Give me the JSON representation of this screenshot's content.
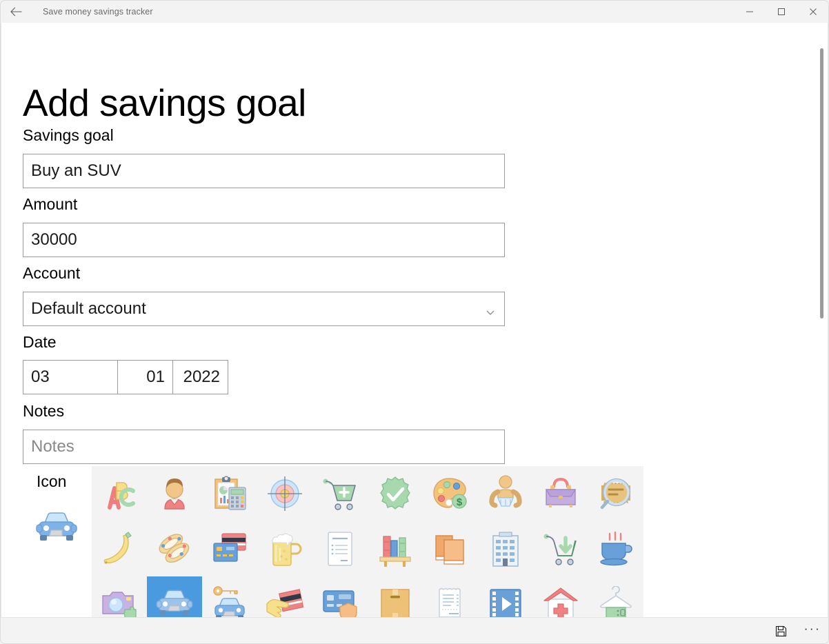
{
  "window": {
    "title": "Save money savings tracker",
    "back_icon": "back-arrow-icon",
    "minimize_label": "–",
    "maximize_label": "□",
    "close_label": "✕"
  },
  "page": {
    "heading": "Add savings goal"
  },
  "form": {
    "savings_goal": {
      "label": "Savings goal",
      "value": "Buy an SUV"
    },
    "amount": {
      "label": "Amount",
      "value": "30000"
    },
    "account": {
      "label": "Account",
      "value": "Default account",
      "options": [
        "Default account"
      ]
    },
    "date": {
      "label": "Date",
      "day": "03",
      "month": "01",
      "year": "2022"
    },
    "notes": {
      "label": "Notes",
      "value": "",
      "placeholder": "Notes"
    },
    "icon": {
      "label": "Icon",
      "selected_index": 21,
      "selected_name": "car-icon",
      "items": [
        {
          "name": "abc-blocks-icon"
        },
        {
          "name": "person-avatar-icon"
        },
        {
          "name": "clipboard-calculator-icon"
        },
        {
          "name": "target-bullseye-icon"
        },
        {
          "name": "cart-add-icon"
        },
        {
          "name": "check-badge-icon"
        },
        {
          "name": "art-palette-money-icon"
        },
        {
          "name": "baby-icon"
        },
        {
          "name": "handbag-icon"
        },
        {
          "name": "magnifier-document-icon"
        },
        {
          "name": "banana-icon"
        },
        {
          "name": "jewelry-bracelet-icon"
        },
        {
          "name": "credit-cards-icon"
        },
        {
          "name": "beer-mug-icon"
        },
        {
          "name": "document-bill-icon"
        },
        {
          "name": "bookshelf-icon"
        },
        {
          "name": "stacked-books-icon"
        },
        {
          "name": "office-building-icon"
        },
        {
          "name": "cart-download-icon"
        },
        {
          "name": "coffee-cup-icon"
        },
        {
          "name": "camera-puzzle-icon"
        },
        {
          "name": "car-icon"
        },
        {
          "name": "car-key-icon"
        },
        {
          "name": "hand-credit-card-icon"
        },
        {
          "name": "card-shield-icon"
        },
        {
          "name": "cardboard-box-icon"
        },
        {
          "name": "receipt-icon"
        },
        {
          "name": "film-video-icon"
        },
        {
          "name": "hospital-icon"
        },
        {
          "name": "hanger-shirt-icon"
        }
      ]
    }
  },
  "commandbar": {
    "save_name": "save-icon",
    "more_label": "···"
  },
  "colors": {
    "accent_selected": "#4a9ae0",
    "panel_bg": "#f3f3f3",
    "border": "#9b9b9b",
    "placeholder": "#898989"
  }
}
